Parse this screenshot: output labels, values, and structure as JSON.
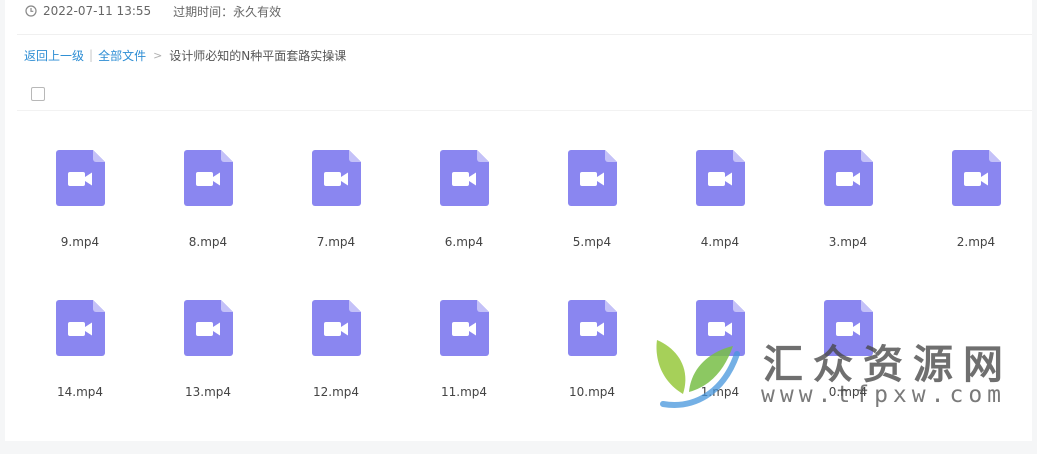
{
  "share": {
    "created_at": "2022-07-11 13:55",
    "expire_label": "过期时间：永久有效"
  },
  "breadcrumb": {
    "back": "返回上一级",
    "separator": "|",
    "root": "全部文件",
    "arrow": ">",
    "current": "设计师必知的N种平面套路实操课"
  },
  "files": [
    {
      "name": "9.mp4",
      "icon": "video-file-icon"
    },
    {
      "name": "8.mp4",
      "icon": "video-file-icon"
    },
    {
      "name": "7.mp4",
      "icon": "video-file-icon"
    },
    {
      "name": "6.mp4",
      "icon": "video-file-icon"
    },
    {
      "name": "5.mp4",
      "icon": "video-file-icon"
    },
    {
      "name": "4.mp4",
      "icon": "video-file-icon"
    },
    {
      "name": "3.mp4",
      "icon": "video-file-icon"
    },
    {
      "name": "2.mp4",
      "icon": "video-file-icon"
    },
    {
      "name": "14.mp4",
      "icon": "video-file-icon"
    },
    {
      "name": "13.mp4",
      "icon": "video-file-icon"
    },
    {
      "name": "12.mp4",
      "icon": "video-file-icon"
    },
    {
      "name": "11.mp4",
      "icon": "video-file-icon"
    },
    {
      "name": "10.mp4",
      "icon": "video-file-icon"
    },
    {
      "name": "1.mp4",
      "icon": "video-file-icon"
    },
    {
      "name": "0.mp4",
      "icon": "video-file-icon"
    }
  ],
  "watermark": {
    "brand": "汇众资源网",
    "url": "www.tfpxw.com"
  },
  "colors": {
    "link": "#2e8ed4",
    "file_icon": "#8a86f0",
    "file_icon_fold": "#c4c1f8"
  }
}
